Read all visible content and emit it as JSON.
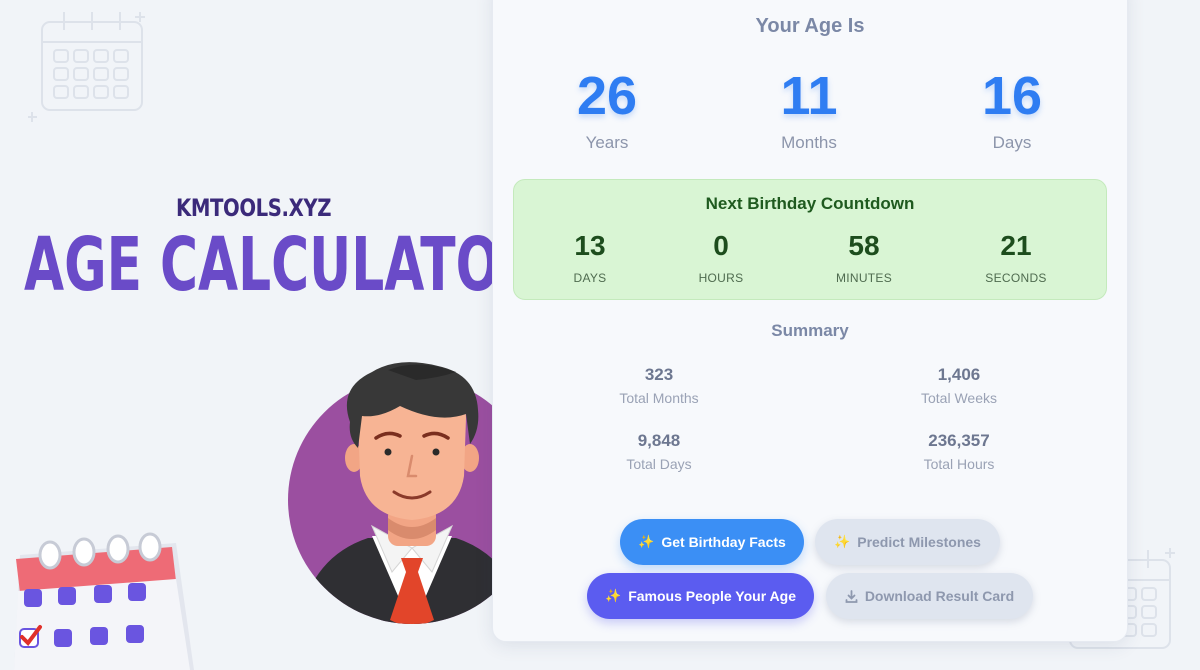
{
  "branding": {
    "site": "KMTOOLS.XYZ",
    "title": "AGE CALCULATOR"
  },
  "result": {
    "title": "Your Age Is",
    "age": [
      {
        "value": "26",
        "label": "Years"
      },
      {
        "value": "11",
        "label": "Months"
      },
      {
        "value": "16",
        "label": "Days"
      }
    ]
  },
  "countdown": {
    "title": "Next Birthday Countdown",
    "units": [
      {
        "value": "13",
        "label": "DAYS"
      },
      {
        "value": "0",
        "label": "HOURS"
      },
      {
        "value": "58",
        "label": "MINUTES"
      },
      {
        "value": "21",
        "label": "SECONDS"
      }
    ]
  },
  "summary": {
    "title": "Summary",
    "items": [
      {
        "value": "323",
        "label": "Total Months"
      },
      {
        "value": "1,406",
        "label": "Total Weeks"
      },
      {
        "value": "9,848",
        "label": "Total Days"
      },
      {
        "value": "236,357",
        "label": "Total Hours"
      }
    ]
  },
  "actions": {
    "birthday_facts": "Get Birthday Facts",
    "predict_milestones": "Predict Milestones",
    "famous_people": "Famous People Your Age",
    "download_card": "Download Result Card",
    "sparkle_icon": "✨",
    "download_icon": "download-icon"
  },
  "colors": {
    "accent_blue": "#2f7df2",
    "brand_purple": "#6a4bc8",
    "countdown_bg": "#d9f5d4",
    "famous_button": "#5b5cf0"
  }
}
